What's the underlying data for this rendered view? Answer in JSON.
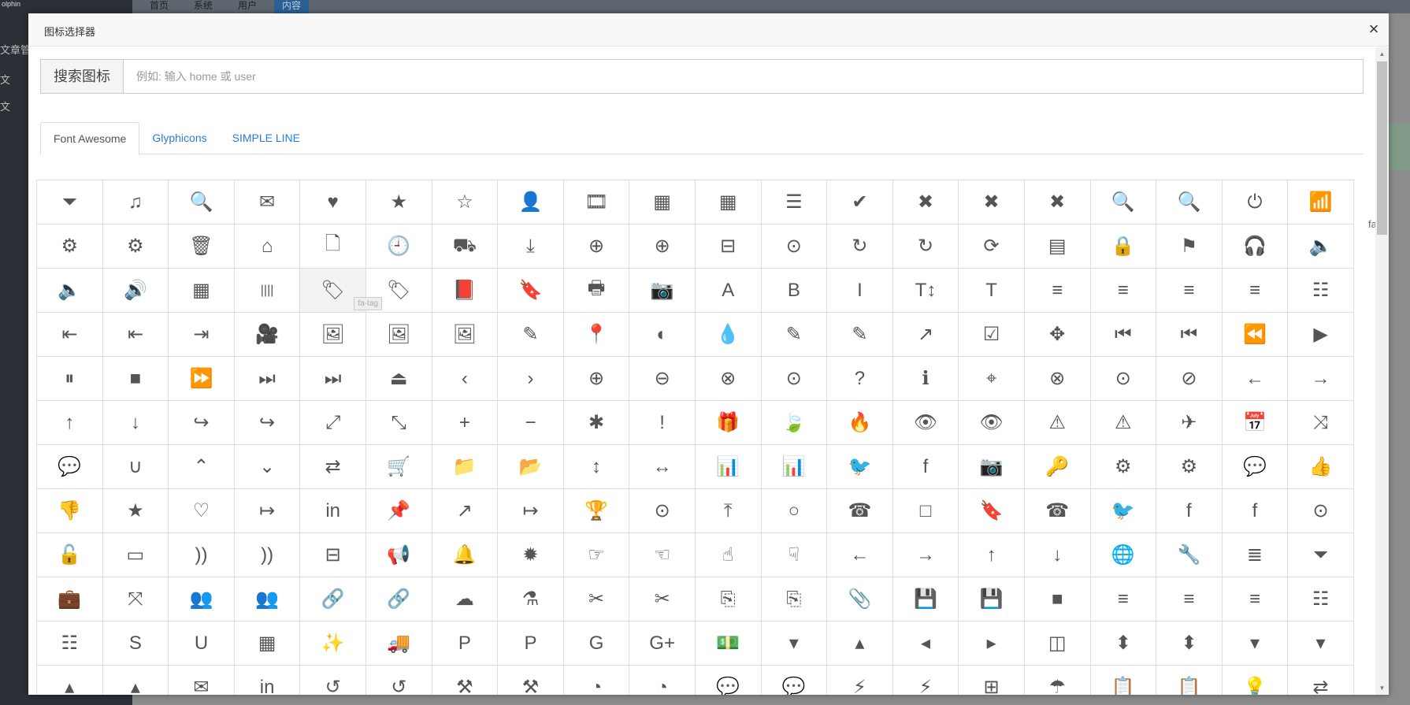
{
  "modal": {
    "title": "图标选择器",
    "close_label": "×"
  },
  "search": {
    "label": "搜索图标",
    "placeholder": "例如: 输入 home 或 user"
  },
  "tabs": [
    {
      "label": "Font Awesome",
      "active": true
    },
    {
      "label": "Glyphicons",
      "active": false
    },
    {
      "label": "SIMPLE LINE",
      "active": false
    }
  ],
  "tooltip": "fa-tag",
  "overflow_label": "fa-",
  "background": {
    "nav": [
      "首页",
      "系统",
      "用户",
      "内容"
    ],
    "sidebar": [
      "文章管",
      "文",
      "文"
    ]
  },
  "icons": [
    "⏷",
    "♫",
    "🔍",
    "✉",
    "♥",
    "★",
    "☆",
    "👤",
    "🎞",
    "▦",
    "▦",
    "☰",
    "✔",
    "✖",
    "✖",
    "✖",
    "🔍",
    "🔍",
    "⏻",
    "📶",
    "⚙",
    "⚙",
    "🗑",
    "⌂",
    "🗋",
    "🕘",
    "⛟",
    "⤓",
    "⊕",
    "⊕",
    "⊟",
    "⊙",
    "↻",
    "↻",
    "⟳",
    "▤",
    "🔒",
    "⚑",
    "🎧",
    "🔈",
    "🔈",
    "🔊",
    "▦",
    "||||",
    "🏷",
    "🏷",
    "📕",
    "🔖",
    "🖶",
    "📷",
    "A",
    "B",
    "I",
    "T↕",
    "T",
    "≡",
    "≡",
    "≡",
    "≡",
    "☷",
    "⇤",
    "⇤",
    "⇥",
    "🎥",
    "🖼",
    "🖼",
    "🖼",
    "✎",
    "📍",
    "◐",
    "💧",
    "✎",
    "✎",
    "↗",
    "☑",
    "✥",
    "⏮",
    "⏮",
    "⏪",
    "▶",
    "⏸",
    "■",
    "⏩",
    "⏭",
    "⏭",
    "⏏",
    "‹",
    "›",
    "⊕",
    "⊖",
    "⊗",
    "⊙",
    "?",
    "ℹ",
    "⌖",
    "⊗",
    "⊙",
    "⊘",
    "←",
    "→",
    "↑",
    "↓",
    "↪",
    "↪",
    "⤢",
    "⤡",
    "+",
    "−",
    "✱",
    "!",
    "🎁",
    "🍃",
    "🔥",
    "👁",
    "👁",
    "⚠",
    "⚠",
    "✈",
    "📅",
    "⤨",
    "💬",
    "∪",
    "⌃",
    "⌄",
    "⇄",
    "🛒",
    "📁",
    "📂",
    "↕",
    "↔",
    "📊",
    "📊",
    "🐦",
    "f",
    "📷",
    "🔑",
    "⚙",
    "⚙",
    "💬",
    "👍",
    "👎",
    "★",
    "♡",
    "↦",
    "in",
    "📌",
    "↗",
    "↦",
    "🏆",
    "⊙",
    "⤒",
    "○",
    "☎",
    "□",
    "🔖",
    "☎",
    "🐦",
    "f",
    "f",
    "⊙",
    "🔓",
    "▭",
    "))",
    "))",
    "⊟",
    "📢",
    "🔔",
    "✹",
    "☞",
    "☜",
    "☝",
    "☟",
    "←",
    "→",
    "↑",
    "↓",
    "🌐",
    "🔧",
    "≣",
    "⏷",
    "💼",
    "⤧",
    "👥",
    "👥",
    "🔗",
    "🔗",
    "☁",
    "⚗",
    "✂",
    "✂",
    "⎘",
    "⎘",
    "📎",
    "💾",
    "💾",
    "■",
    "≡",
    "≡",
    "≡",
    "☷",
    "☷",
    "S",
    "U",
    "▦",
    "✨",
    "🚚",
    "P",
    "P",
    "G",
    "G+",
    "💵",
    "▾",
    "▴",
    "◂",
    "▸",
    "◫",
    "⬍",
    "⬍",
    "▾",
    "▾",
    "▴",
    "▴",
    "✉",
    "in",
    "↺",
    "↺",
    "⚒",
    "⚒",
    "◔",
    "◔",
    "💬",
    "💬",
    "⚡",
    "⚡",
    "⊞",
    "☂",
    "📋",
    "📋",
    "💡",
    "⇄"
  ]
}
